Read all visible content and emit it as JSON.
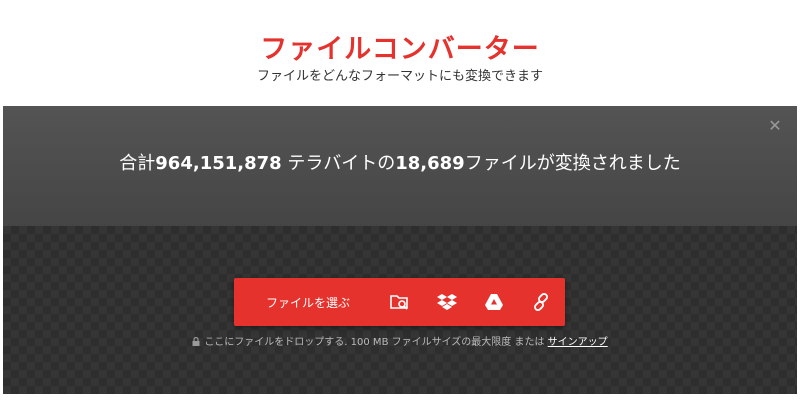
{
  "header": {
    "title": "ファイルコンバーター",
    "subtitle": "ファイルをどんなフォーマットにも変換できます"
  },
  "stats": {
    "prefix": "合計",
    "terabytes": "964,151,878",
    "middle": " テラバイトの",
    "files": "18,689",
    "suffix": "ファイルが変換されました"
  },
  "close": {
    "icon": "close-icon",
    "glyph": "✕"
  },
  "upload": {
    "choose_label": "ファイルを選ぶ",
    "sources": [
      "folder-search-icon",
      "dropbox-icon",
      "google-drive-icon",
      "link-icon"
    ]
  },
  "hint": {
    "text": "ここにファイルをドロップする. 100 MB ファイルサイズの最大限度 または ",
    "signup_label": "サインアップ"
  },
  "colors": {
    "accent": "#e5322d",
    "panel": "#2e2e2e",
    "band": "#4d4d4d"
  }
}
